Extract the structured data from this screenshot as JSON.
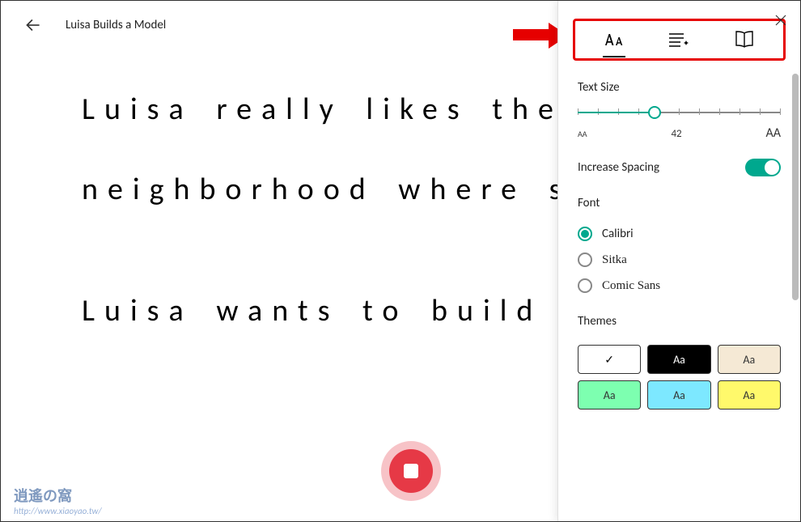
{
  "header": {
    "title": "Luisa Builds a Model"
  },
  "content": {
    "line1": "Luisa really likes the",
    "line2": "neighborhood where she",
    "line3": "Luisa wants to build a m"
  },
  "panel": {
    "textSize": {
      "label": "Text Size",
      "value": "42",
      "smallIcon": "AA",
      "largeIcon": "AA"
    },
    "spacing": {
      "label": "Increase Spacing",
      "on": true
    },
    "font": {
      "label": "Font",
      "options": [
        {
          "label": "Calibri",
          "selected": true
        },
        {
          "label": "Sitka",
          "selected": false
        },
        {
          "label": "Comic Sans",
          "selected": false
        }
      ]
    },
    "themes": {
      "label": "Themes",
      "items": [
        {
          "bg": "#ffffff",
          "fg": "#000000",
          "label": "✓",
          "selected": true
        },
        {
          "bg": "#000000",
          "fg": "#ffffff",
          "label": "Aa"
        },
        {
          "bg": "#f5e9d5",
          "fg": "#333333",
          "label": "Aa"
        },
        {
          "bg": "#7dffb0",
          "fg": "#333333",
          "label": "Aa"
        },
        {
          "bg": "#7de8ff",
          "fg": "#333333",
          "label": "Aa"
        },
        {
          "bg": "#fff96b",
          "fg": "#333333",
          "label": "Aa"
        }
      ]
    }
  },
  "watermark": {
    "line1": "逍遙の窩",
    "line2": "http://www.xiaoyao.tw/"
  }
}
